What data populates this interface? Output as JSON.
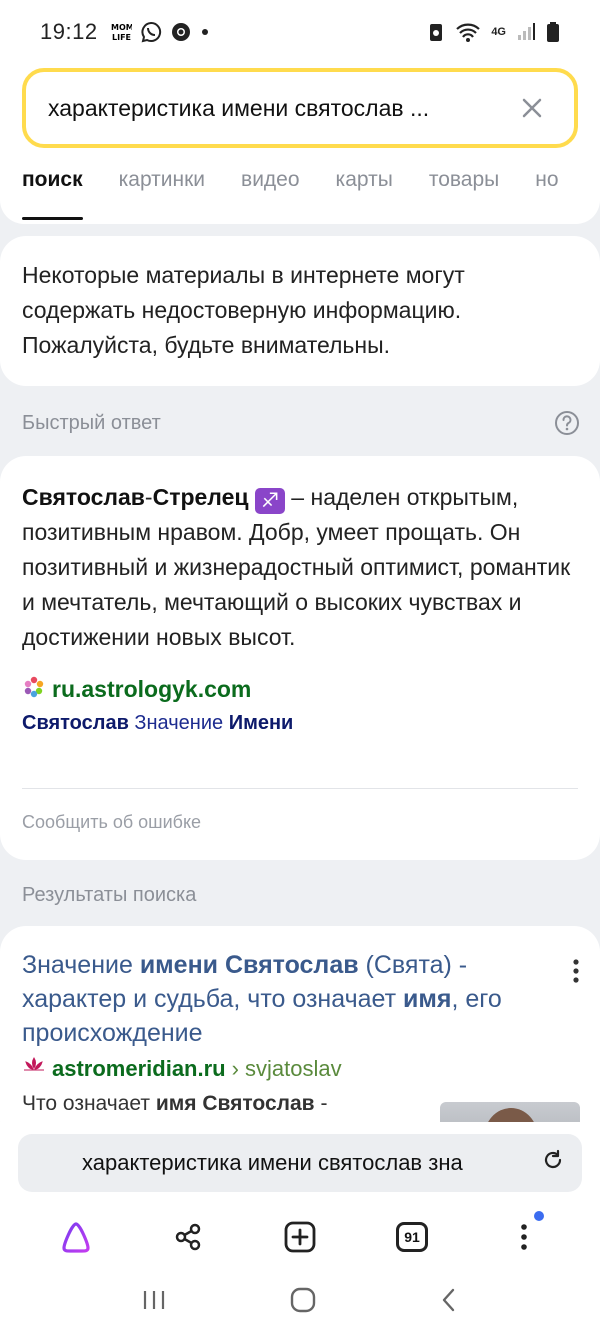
{
  "status_bar": {
    "time": "19:12",
    "network": "4G"
  },
  "search": {
    "query": "характеристика имени святослав ..."
  },
  "tabs": [
    {
      "label": "поиск",
      "active": true
    },
    {
      "label": "картинки",
      "active": false
    },
    {
      "label": "видео",
      "active": false
    },
    {
      "label": "карты",
      "active": false
    },
    {
      "label": "товары",
      "active": false
    },
    {
      "label": "но",
      "active": false
    }
  ],
  "warning": {
    "text": "Некоторые материалы в интернете могут содержать недостоверную информацию. Пожалуйста, будьте внимательны."
  },
  "quick_answer": {
    "section_title": "Быстрый ответ",
    "bold_name": "Святослав",
    "dash": "-",
    "bold_sign": "Стрелец",
    "zodiac_glyph": "♐",
    "body": " – наделен открытым, позитивным нравом. Добр, умеет прощать. Он позитивный и жизнерадостный оптимист, романтик и мечтатель, мечтающий о высоких чувствах и достижении новых высот.",
    "source_domain": "ru.astrologyk.com",
    "source_sub_1": "Святослав",
    "source_sub_2": " Значение ",
    "source_sub_3": "Имени",
    "report": "Сообщить об ошибке"
  },
  "results": {
    "section_title": "Результаты поиска",
    "items": [
      {
        "title_1": "Значение ",
        "title_2": "имени Святослав",
        "title_3": " (Свята) - характер и судьба, что означает ",
        "title_4": "имя",
        "title_5": ", его происхождение",
        "domain": "astromeridian.ru",
        "path": " › svjatoslav",
        "snippet_1": "Что означает ",
        "snippet_2": "имя Святослав",
        "snippet_3": " -"
      }
    ]
  },
  "bottom": {
    "url_text": "характеристика имени святослав зна"
  },
  "toolbar": {
    "tab_count": "91"
  },
  "colors": {
    "search_border": "#ffdb4d",
    "source_green": "#0b6b1d",
    "link_title": "#3a5a8c",
    "zodiac_purple": "#8a45c9",
    "notification_dot": "#3b6cf0"
  }
}
